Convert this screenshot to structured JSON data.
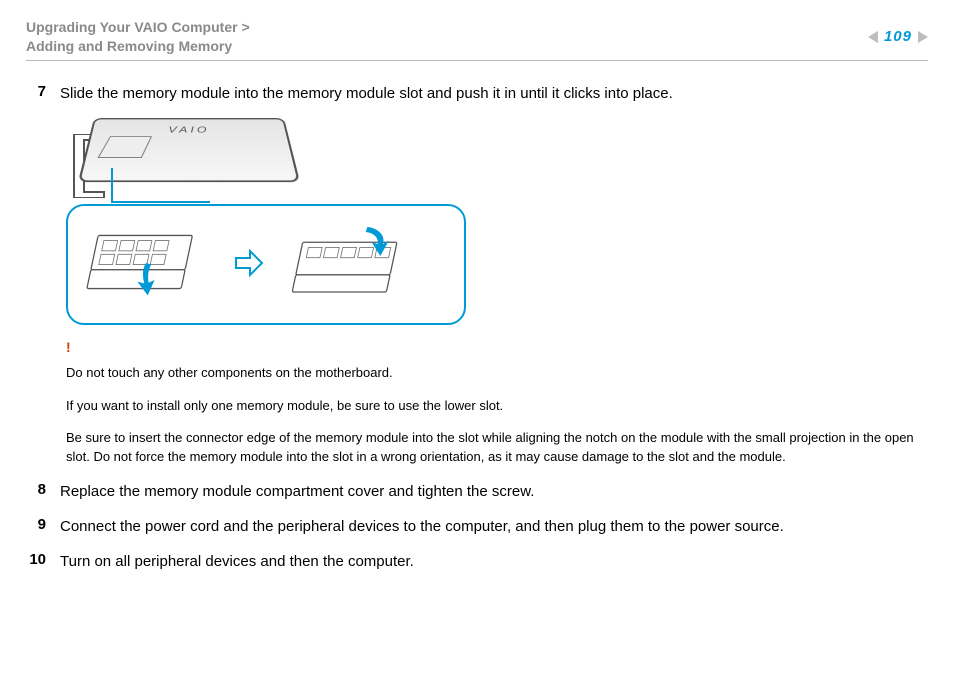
{
  "header": {
    "breadcrumb_section": "Upgrading Your VAIO Computer",
    "breadcrumb_sep": ">",
    "breadcrumb_topic": "Adding and Removing Memory",
    "page_number": "109"
  },
  "steps": [
    {
      "num": "7",
      "text": "Slide the memory module into the memory module slot and push it in until it clicks into place."
    },
    {
      "num": "8",
      "text": "Replace the memory module compartment cover and tighten the screw."
    },
    {
      "num": "9",
      "text": "Connect the power cord and the peripheral devices to the computer, and then plug them to the power source."
    },
    {
      "num": "10",
      "text": "Turn on all peripheral devices and then the computer."
    }
  ],
  "figure": {
    "device_logo": "VAIO"
  },
  "notes": {
    "warn_mark": "!",
    "n1": "Do not touch any other components on the motherboard.",
    "n2": "If you want to install only one memory module, be sure to use the lower slot.",
    "n3": "Be sure to insert the connector edge of the memory module into the slot while aligning the notch on the module with the small projection in the open slot. Do not force the memory module into the slot in a wrong orientation, as it may cause damage to the slot and the module."
  }
}
